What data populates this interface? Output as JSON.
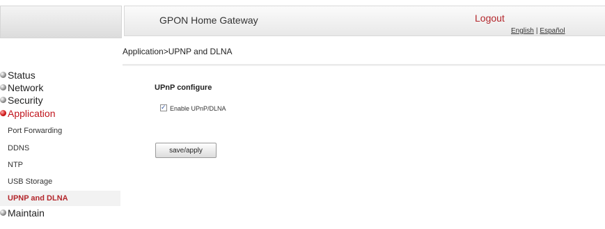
{
  "header": {
    "title": "GPON Home Gateway",
    "logout": "Logout",
    "lang_english": "English",
    "lang_separator": "|",
    "lang_spanish": "Español"
  },
  "breadcrumb": "Application>UPNP and DLNA",
  "sidebar": {
    "menu": [
      {
        "label": "Status",
        "icon": "bullet-icon"
      },
      {
        "label": "Network",
        "icon": "bullet-icon"
      },
      {
        "label": "Security",
        "icon": "bullet-icon"
      },
      {
        "label": "Application",
        "icon": "bullet-icon",
        "active": true
      },
      {
        "label": "Maintain",
        "icon": "bullet-icon"
      }
    ],
    "submenu": [
      {
        "label": "Port Forwarding"
      },
      {
        "label": "DDNS"
      },
      {
        "label": "NTP"
      },
      {
        "label": "USB Storage"
      },
      {
        "label": "UPNP and DLNA",
        "selected": true
      }
    ]
  },
  "main": {
    "section_title": "UPnP configure",
    "checkbox": {
      "label": "Enable UPnP/DLNA",
      "checked": true
    },
    "save_button": "save/apply"
  },
  "colors": {
    "accent": "#b3262b"
  }
}
